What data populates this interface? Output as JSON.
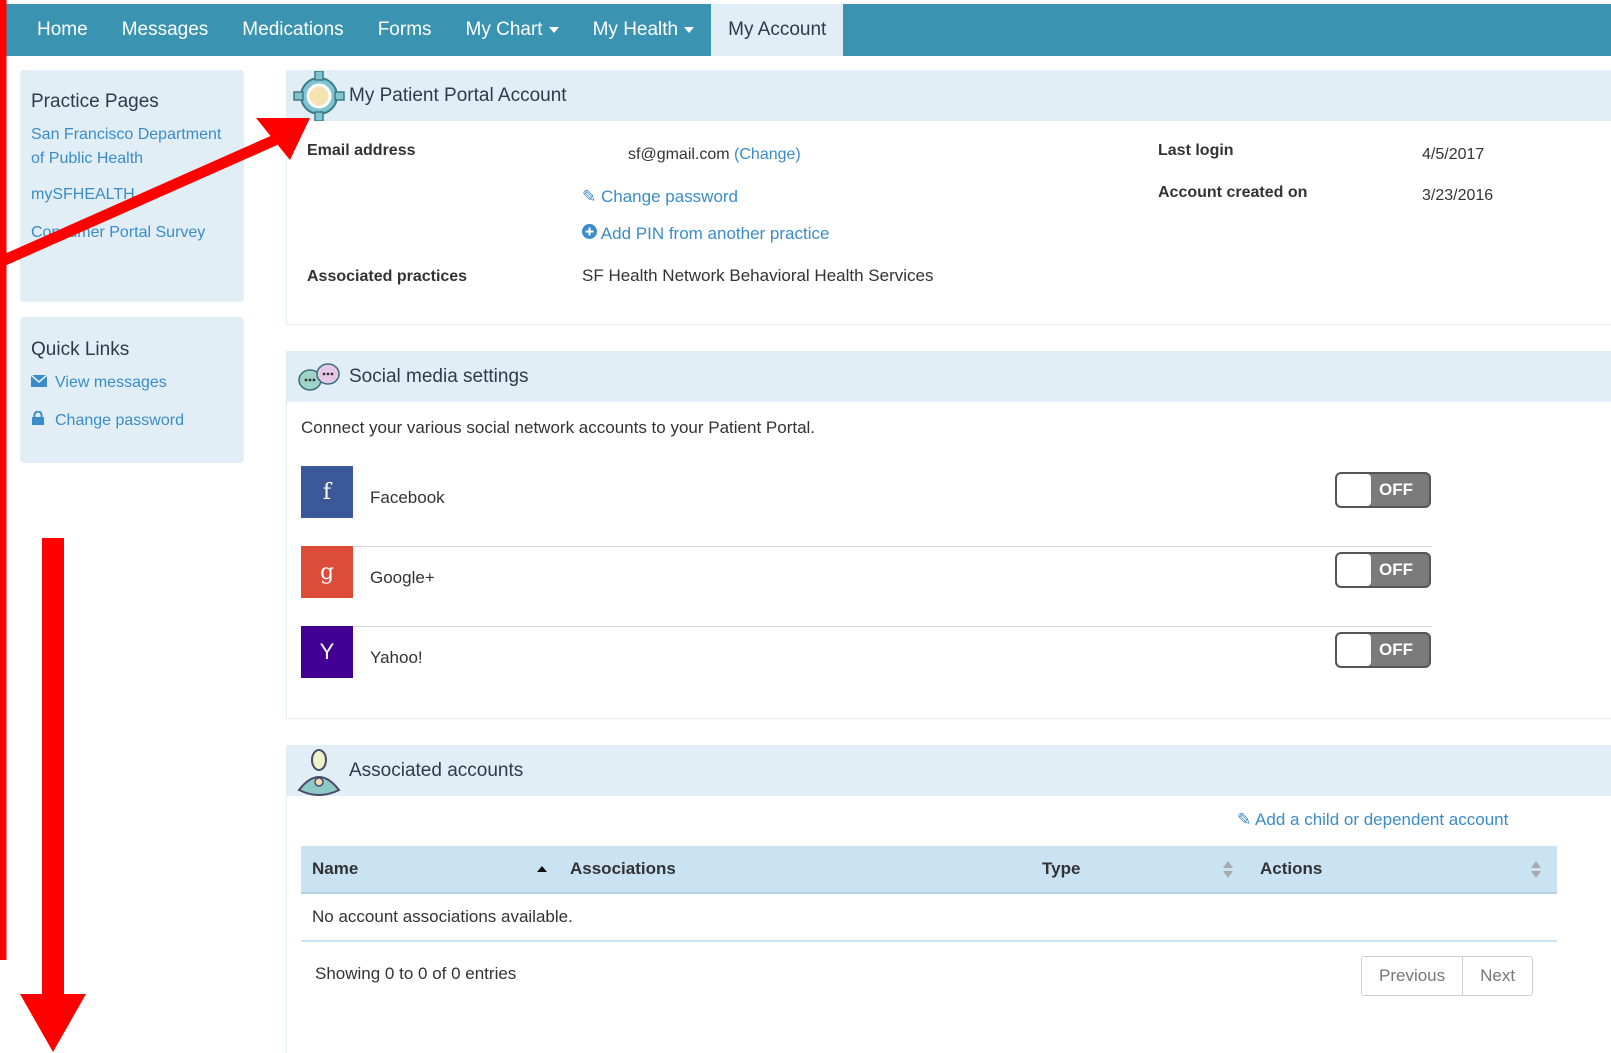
{
  "nav": {
    "items": [
      {
        "label": "Home"
      },
      {
        "label": "Messages"
      },
      {
        "label": "Medications"
      },
      {
        "label": "Forms"
      },
      {
        "label": "My Chart"
      },
      {
        "label": "My Health"
      },
      {
        "label": "My Account"
      }
    ]
  },
  "sidebar": {
    "practice_title": "Practice Pages",
    "practice_links": [
      "San Francisco Department of Public Health",
      "mySFHEALTH",
      "Consumer Portal Survey"
    ],
    "quick_title": "Quick Links",
    "quick_links": [
      "View messages",
      "Change password"
    ]
  },
  "account": {
    "title": "My Patient Portal Account",
    "email_label": "Email address",
    "email_value": "sf@gmail.com",
    "change_link": "(Change)",
    "change_password": "Change password",
    "add_pin": "Add PIN from another practice",
    "practices_label": "Associated practices",
    "practices_value": "SF Health Network Behavioral Health Services",
    "last_login_label": "Last login",
    "last_login_value": "4/5/2017",
    "created_label": "Account created on",
    "created_value": "3/23/2016"
  },
  "social": {
    "title": "Social media settings",
    "description": "Connect your various social network accounts to your Patient Portal.",
    "toggle_off": "OFF",
    "networks": [
      {
        "name": "Facebook",
        "glyph": "f",
        "color": "#3b5998"
      },
      {
        "name": "Google+",
        "glyph": "g",
        "color": "#dd4b39"
      },
      {
        "name": "Yahoo!",
        "glyph": "Y",
        "color": "#410093"
      }
    ]
  },
  "associated": {
    "title": "Associated accounts",
    "add_link": "Add a child or dependent account",
    "columns": [
      "Name",
      "Associations",
      "Type",
      "Actions"
    ],
    "empty_message": "No account associations available.",
    "showing": "Showing 0 to 0 of 0 entries",
    "prev": "Previous",
    "next": "Next"
  },
  "colors": {
    "navbar": "#3a93b0",
    "panel_bg": "#e1eef6",
    "link": "#3a8cc8",
    "annotation": "#ff0000"
  }
}
